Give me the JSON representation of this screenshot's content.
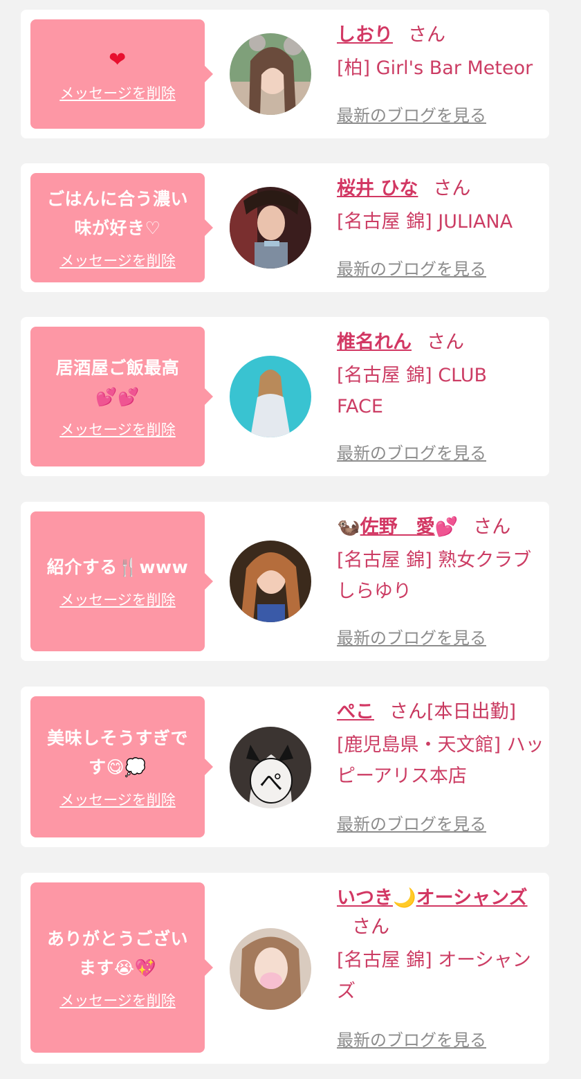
{
  "cards": [
    {
      "message": "",
      "message_emoji": "❤",
      "delete_label": "メッセージを削除",
      "name": "しおり",
      "honorific": "さん",
      "shop": "[柏] Girl's Bar Meteor",
      "blog_label": "最新のブログを見る",
      "avatar_icon": "avatar-photo"
    },
    {
      "message": "ごはんに合う濃い味が好き♡",
      "delete_label": "メッセージを削除",
      "name": "桜井 ひな",
      "honorific": "さん",
      "shop": "[名古屋 錦] JULIANA",
      "blog_label": "最新のブログを見る",
      "avatar_icon": "avatar-photo"
    },
    {
      "message": "居酒屋ご飯最高",
      "message_emoji": "💕💕",
      "delete_label": "メッセージを削除",
      "name": "椎名れん",
      "honorific": "さん",
      "shop": "[名古屋 錦] CLUB FACE",
      "blog_label": "最新のブログを見る",
      "avatar_icon": "avatar-photo"
    },
    {
      "message": "紹介する",
      "message_emoji": "🍴",
      "message_suffix": "www",
      "delete_label": "メッセージを削除",
      "name_prefix_emoji": "🦦",
      "name": "佐野　愛",
      "name_suffix_emoji": "💕",
      "honorific": "さん",
      "shop": "[名古屋 錦] 熟女クラブしらゆり",
      "blog_label": "最新のブログを見る",
      "avatar_icon": "avatar-photo"
    },
    {
      "message": "美味しそうすぎです",
      "message_emoji": "😋💭",
      "delete_label": "メッセージを削除",
      "name": "ぺこ",
      "honorific": "さん[本日出勤]",
      "shop": "[鹿児島県・天文館] ハッピーアリス本店",
      "blog_label": "最新のブログを見る",
      "avatar_icon": "avatar-photo"
    },
    {
      "message": "ありがとうございます",
      "message_emoji": "😭💖",
      "delete_label": "メッセージを削除",
      "name": "いつき",
      "name_mid_emoji": "🌙",
      "name_rest": "オーシャンズ",
      "honorific": "さん",
      "shop": "[名古屋 錦] オーシャンズ",
      "blog_label": "最新のブログを見る",
      "avatar_icon": "avatar-photo"
    }
  ],
  "colors": {
    "page_bg": "#f2f2f2",
    "card_bg": "#ffffff",
    "bubble_bg": "#fd97a5",
    "name": "#d23763",
    "shop": "#cc3d64",
    "blog_link": "#8c8c8c"
  }
}
